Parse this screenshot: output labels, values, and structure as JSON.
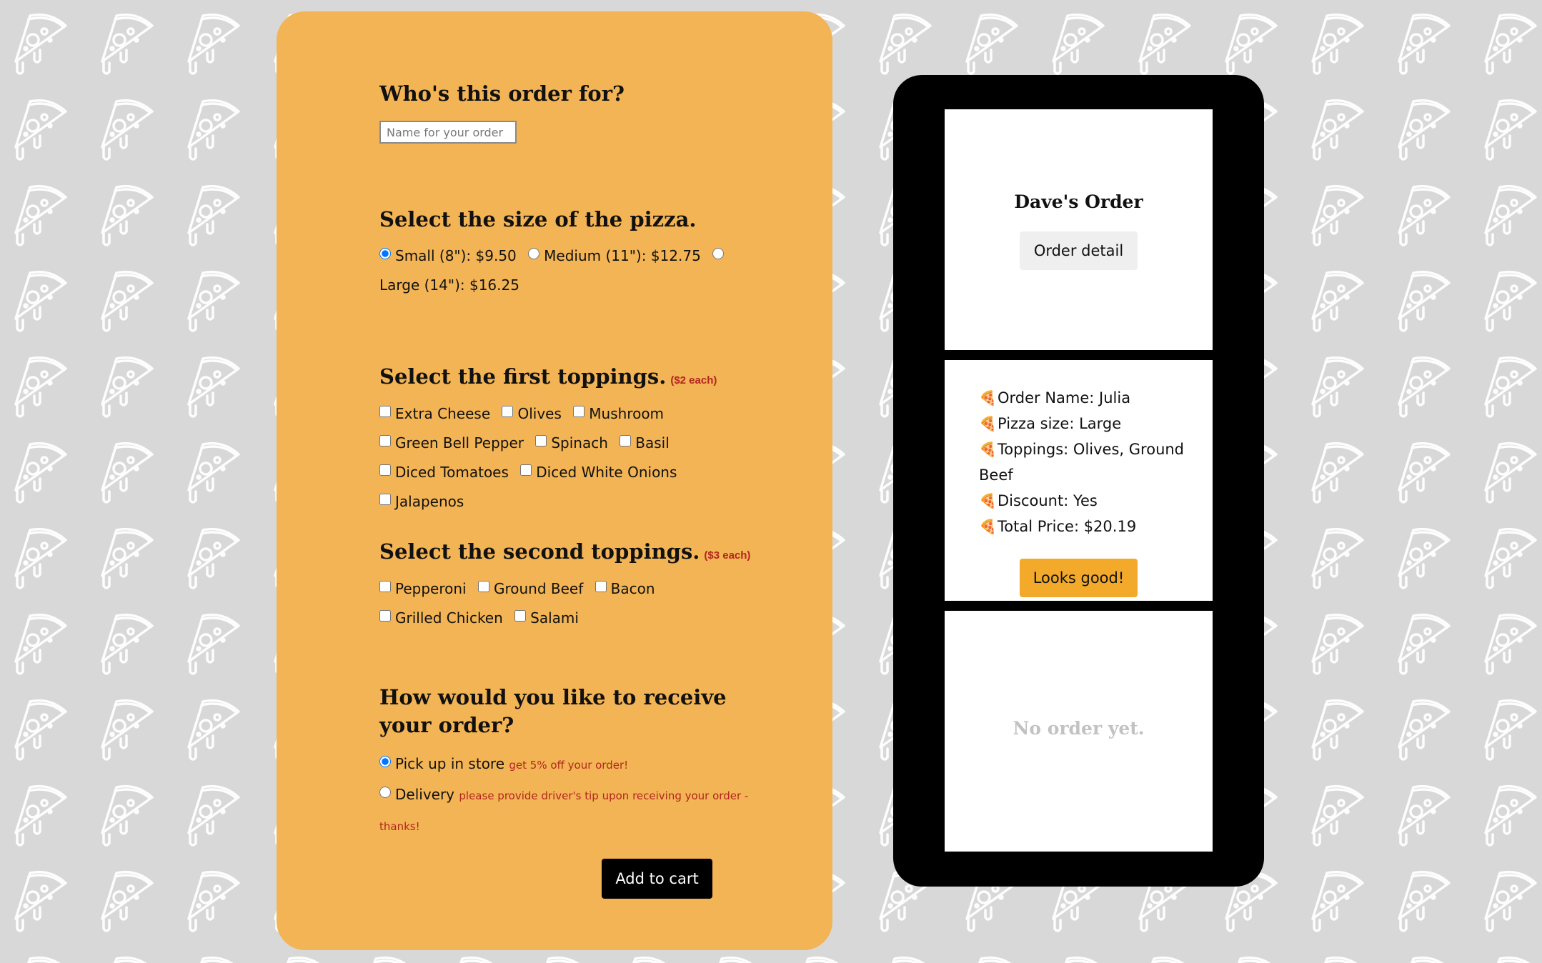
{
  "form": {
    "name_section": {
      "title": "Who's this order for?",
      "placeholder": "Name for your order"
    },
    "size_section": {
      "title": "Select the size of the pizza.",
      "options": [
        {
          "label": "Small (8\"): $9.50",
          "checked": true
        },
        {
          "label": "Medium (11\"): $12.75",
          "checked": false
        },
        {
          "label": "Large (14\"): $16.25",
          "checked": false
        }
      ]
    },
    "first_toppings": {
      "title": "Select the first toppings.",
      "note": "($2 each)",
      "options": [
        "Extra Cheese",
        "Olives",
        "Mushroom",
        "Green Bell Pepper",
        "Spinach",
        "Basil",
        "Diced Tomatoes",
        "Diced White Onions",
        "Jalapenos"
      ]
    },
    "second_toppings": {
      "title": "Select the second toppings.",
      "note": "($3 each)",
      "options": [
        "Pepperoni",
        "Ground Beef",
        "Bacon",
        "Grilled Chicken",
        "Salami"
      ]
    },
    "delivery_section": {
      "title": "How would you like to receive your order?",
      "options": [
        {
          "label": "Pick up in store",
          "note": "get 5% off your order!",
          "checked": true
        },
        {
          "label": "Delivery",
          "note": "please provide driver's tip upon receiving your order - thanks!",
          "checked": false
        }
      ]
    },
    "submit_label": "Add to cart"
  },
  "preview": {
    "order_title": "Dave's Order",
    "detail_button": "Order detail",
    "details": [
      "Order Name: Julia",
      "Pizza size: Large",
      "Toppings: Olives, Ground Beef",
      "Discount: Yes",
      "Total Price: $20.19"
    ],
    "bullet_icon": "pizza-slice-emoji",
    "confirm_button": "Looks good!",
    "empty_message": "No order yet."
  },
  "colors": {
    "form_background": "#f3b455",
    "page_background": "#d8d8d8",
    "accent_button": "#f3aa2b",
    "note_red": "#b3261e",
    "phone_frame": "#000000"
  }
}
